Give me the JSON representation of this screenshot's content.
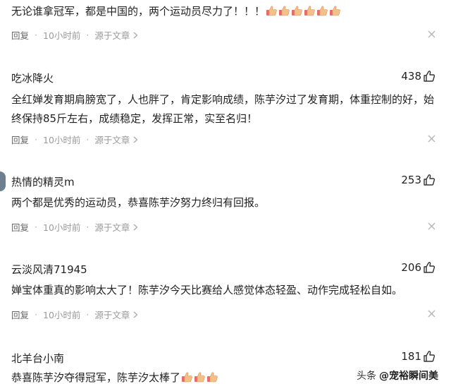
{
  "meta_labels": {
    "reply": "回复",
    "time": "10小时前",
    "source": "源于文章"
  },
  "comments": [
    {
      "user": "",
      "likes": "",
      "text": "无论谁拿冠军，都是中国的，两个运动员尽力了！！！",
      "emoji_count": 6,
      "emoji_name": "thumbs-up-emoji"
    },
    {
      "user": "吃冰降火",
      "likes": "438",
      "text": "全红婵发育期肩膀宽了，人也胖了，肯定影响成绩，陈芋汐过了发育期，体重控制的好，始终保持85斤左右，成绩稳定，发挥正常，实至名归！"
    },
    {
      "user": "热情的精灵m",
      "likes": "253",
      "text": "两个都是优秀的运动员，恭喜陈芋汐努力终归有回报。"
    },
    {
      "user": "云淡风清71945",
      "likes": "206",
      "text": "婵宝体重真的影响太大了！陈芋汐今天比赛给人感觉体态轻盈、动作完成轻松自如。"
    },
    {
      "user": "北羊台小南",
      "likes": "181",
      "text": "恭喜陈芋汐夺得冠军，陈芋汐太棒了",
      "emoji_count": 3,
      "emoji_name": "thumbs-up-emoji"
    }
  ],
  "watermark": {
    "prefix": "头条",
    "handle": "@宠裕瞬间美"
  },
  "colors": {
    "text": "#222222",
    "meta": "#999999",
    "emoji_skin": "#f4c08a",
    "emoji_cuff": "#e86a6a"
  }
}
